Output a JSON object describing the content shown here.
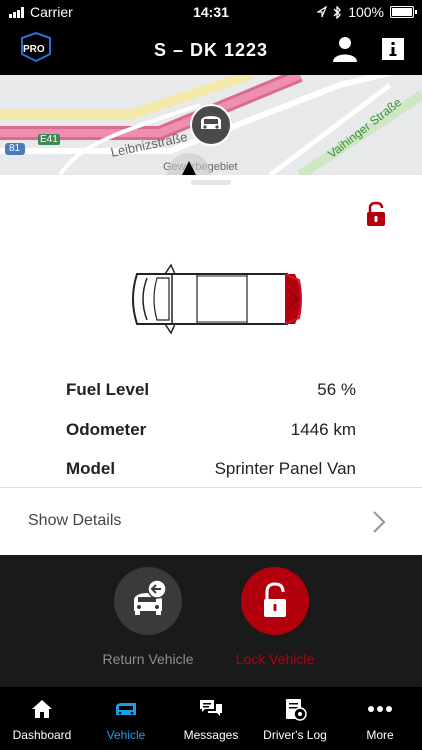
{
  "status_bar": {
    "carrier": "Carrier",
    "time": "14:31",
    "battery": "100%"
  },
  "header": {
    "title": "S – DK 1223",
    "logo_text": "PRO"
  },
  "map": {
    "labels": [
      "Leibnizstraße",
      "Gewerbegebiet",
      "Vaihinger Straße",
      "81",
      "E41"
    ]
  },
  "vehicle": {
    "lock_state": "unlocked"
  },
  "info": [
    {
      "label": "Fuel Level",
      "value": "56 %"
    },
    {
      "label": "Odometer",
      "value": "1446 km"
    },
    {
      "label": "Model",
      "value": "Sprinter Panel Van"
    }
  ],
  "show_details": {
    "label": "Show Details"
  },
  "actions": {
    "return_label": "Return Vehicle",
    "lock_label": "Lock Vehicle"
  },
  "tabs": [
    {
      "label": "Dashboard",
      "icon": "home-icon"
    },
    {
      "label": "Vehicle",
      "icon": "van-icon"
    },
    {
      "label": "Messages",
      "icon": "messages-icon"
    },
    {
      "label": "Driver's Log",
      "icon": "drivers-log-icon"
    },
    {
      "label": "More",
      "icon": "more-icon"
    }
  ],
  "colors": {
    "accent": "#1aa0e6",
    "lock_red": "#b3000f",
    "dark": "#1a1a1a"
  }
}
